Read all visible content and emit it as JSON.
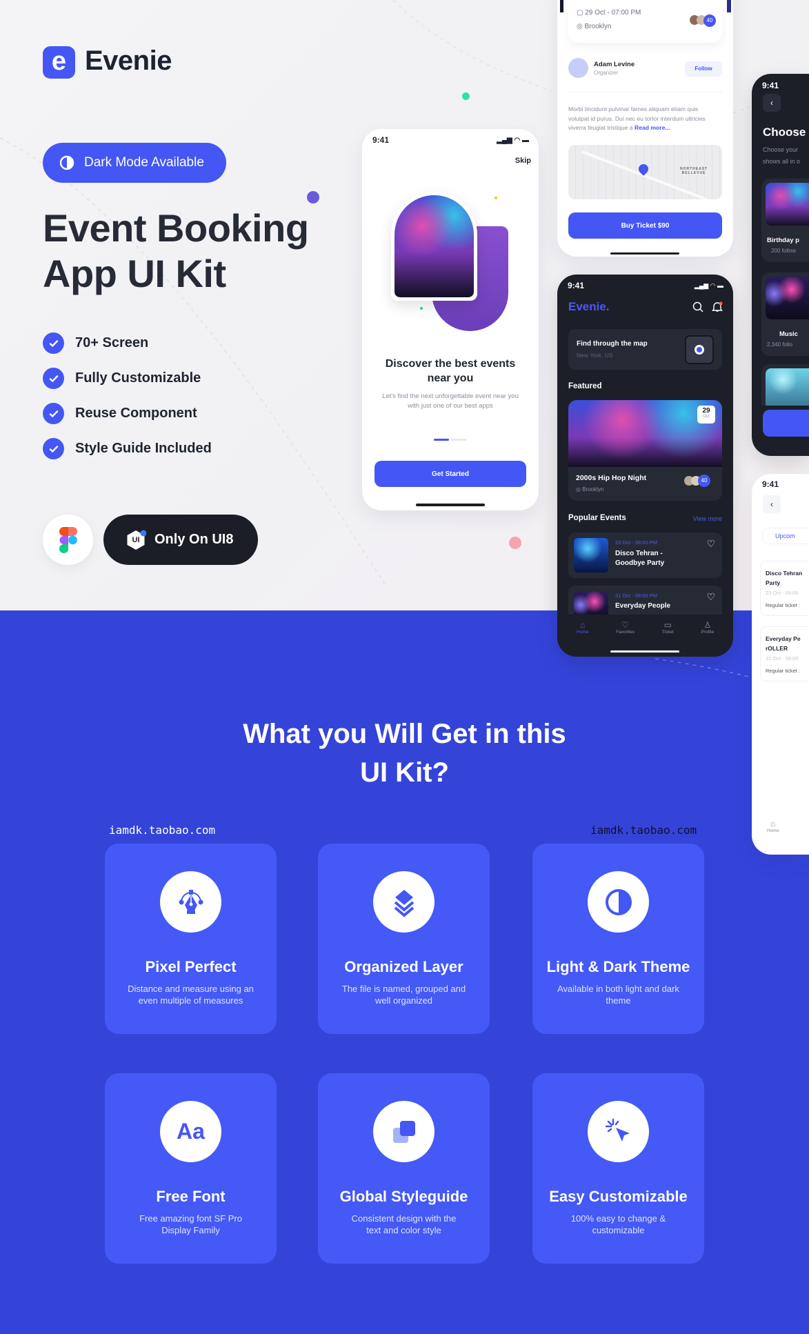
{
  "brand": {
    "logo_letter": "e",
    "name": "Evenie",
    "accent": "#4457f4"
  },
  "hero": {
    "badge": "Dark Mode Available",
    "title_line1": "Event Booking",
    "title_line2": "App UI Kit",
    "features": [
      "70+ Screen",
      "Fully Customizable",
      "Reuse Component",
      "Style Guide Included"
    ],
    "ui8_label": "Only On UI8",
    "ui8_badge": "UI"
  },
  "onboarding": {
    "time": "9:41",
    "skip": "Skip",
    "title_line1": "Discover the best events",
    "title_line2": "near you",
    "desc_line1": "Let's find the next unforgettable event near you",
    "desc_line2": "with just one of our best apps",
    "button": "Get Started"
  },
  "detail": {
    "date": "29 Oct - 07:00 PM",
    "location": "Brooklyn",
    "attendees": "40",
    "organizer_name": "Adam Levine",
    "organizer_role": "Organizer",
    "follow": "Follow",
    "desc_line1": "Morbi tincidunt pulvinar fames aliquam etiam quis",
    "desc_line2": "volutpat id purus. Dui nec eu tortor interdum ultricies",
    "desc_line3": "viverra feugiat tristique a",
    "read_more": "Read more...",
    "map_label_line1": "NORTHEAST",
    "map_label_line2": "BELLEVUE",
    "button": "Buy Ticket $90"
  },
  "home": {
    "time": "9:41",
    "brand": "Evenie.",
    "map_title": "Find through the map",
    "map_sub": "New York, US",
    "featured": "Featured",
    "featured_event": {
      "day": "29",
      "month": "Oct",
      "title": "2000s Hip Hop Night",
      "location": "Brooklyn",
      "attendees": "40"
    },
    "popular": "Popular Events",
    "view_more": "View more",
    "events": [
      {
        "date": "23 Oct - 08:00 PM",
        "title_line1": "Disco Tehran -",
        "title_line2": "Goodbye Party"
      },
      {
        "date": "31 Oct - 08:00 PM",
        "title_line1": "Everyday People"
      }
    ],
    "tabs": [
      "Home",
      "Favorites",
      "Ticket",
      "Profile"
    ]
  },
  "choose": {
    "time": "9:41",
    "title": "Choose",
    "desc_line1": "Choose your",
    "desc_line2": "shows all in o",
    "items": [
      {
        "name": "Birthday p",
        "followers": "200 follow"
      },
      {
        "name": "Music",
        "followers": "2,340 follo"
      }
    ]
  },
  "tickets": {
    "time": "9:41",
    "tab": "Upcom",
    "items": [
      {
        "line1": "Disco Tehran",
        "line2": "Party",
        "date": "23 Oct - 08:00",
        "ticket": "Regular ticket :"
      },
      {
        "line1": "Everyday Pe",
        "line2": "rOLLER",
        "date": "31 Oct - 08:00",
        "ticket": "Regular ticket :"
      }
    ],
    "home_tab": "Home"
  },
  "section": {
    "title_line1": "What you Will Get in this",
    "title_line2": "UI Kit?",
    "watermark_left": "iamdk.taobao.com",
    "watermark_right": "iamdk.taobao.com",
    "cards": [
      {
        "icon": "pen-tool-icon",
        "title": "Pixel Perfect",
        "desc_line1": "Distance and measure using an",
        "desc_line2": "even multiple of measures"
      },
      {
        "icon": "layers-icon",
        "title": "Organized Layer",
        "desc_line1": "The file is named, grouped and",
        "desc_line2": "well organized"
      },
      {
        "icon": "contrast-icon",
        "title": "Light & Dark Theme",
        "desc_line1": "Available in both light and dark",
        "desc_line2": "theme"
      },
      {
        "icon": "font-icon",
        "title": "Free Font",
        "desc_line1": "Free amazing font SF Pro",
        "desc_line2": "Display Family",
        "glyph": "Aa"
      },
      {
        "icon": "styleguide-icon",
        "title": "Global Styleguide",
        "desc_line1": "Consistent design with the",
        "desc_line2": "text and color style"
      },
      {
        "icon": "cursor-click-icon",
        "title": "Easy Customizable",
        "desc_line1": "100% easy to change &",
        "desc_line2": "customizable"
      }
    ]
  },
  "colors": {
    "section_bg": "#3444d9",
    "card_bg": "#4459f6",
    "dark_phone": "#1c1f28"
  }
}
